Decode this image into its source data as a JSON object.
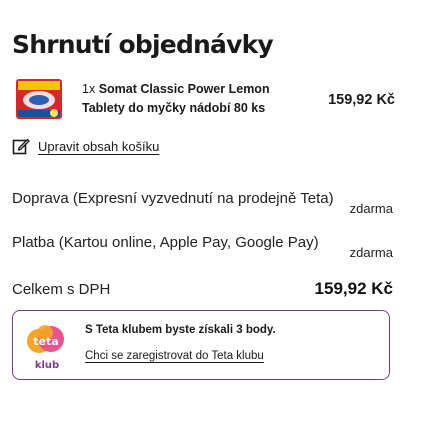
{
  "summary": {
    "title": "Shrnutí objednávky"
  },
  "product": {
    "quantity": "1x",
    "name_line1": "Somat Classic Power Lemon",
    "name_line2": "Tablety do myčky nádobí 80 ks",
    "price": "159,92 Kč",
    "thumbnail_icon": "somat-product-image"
  },
  "cart": {
    "edit_label": "Upravit obsah košíku",
    "edit_icon": "edit-icon"
  },
  "costs": {
    "shipping_label": "Doprava (Expresní vyzvednutí na prodejně Teta)",
    "shipping_value": "zdarma",
    "payment_label": "Platba (Kartou online, Apple Pay, Google Pay)",
    "payment_value": "zdarma",
    "total_label": "Celkem s DPH",
    "total_value": "159,92 Kč"
  },
  "teta_club": {
    "logo_word_top": "teta",
    "logo_word_bottom": "klub",
    "message": "S Teta klubem byste získali 3 body.",
    "register_link": "Chci se zaregistrovat do Teta klubu",
    "colors": {
      "orange": "#f5a623",
      "pink": "#e94b8a",
      "purple": "#7a3d82"
    }
  }
}
